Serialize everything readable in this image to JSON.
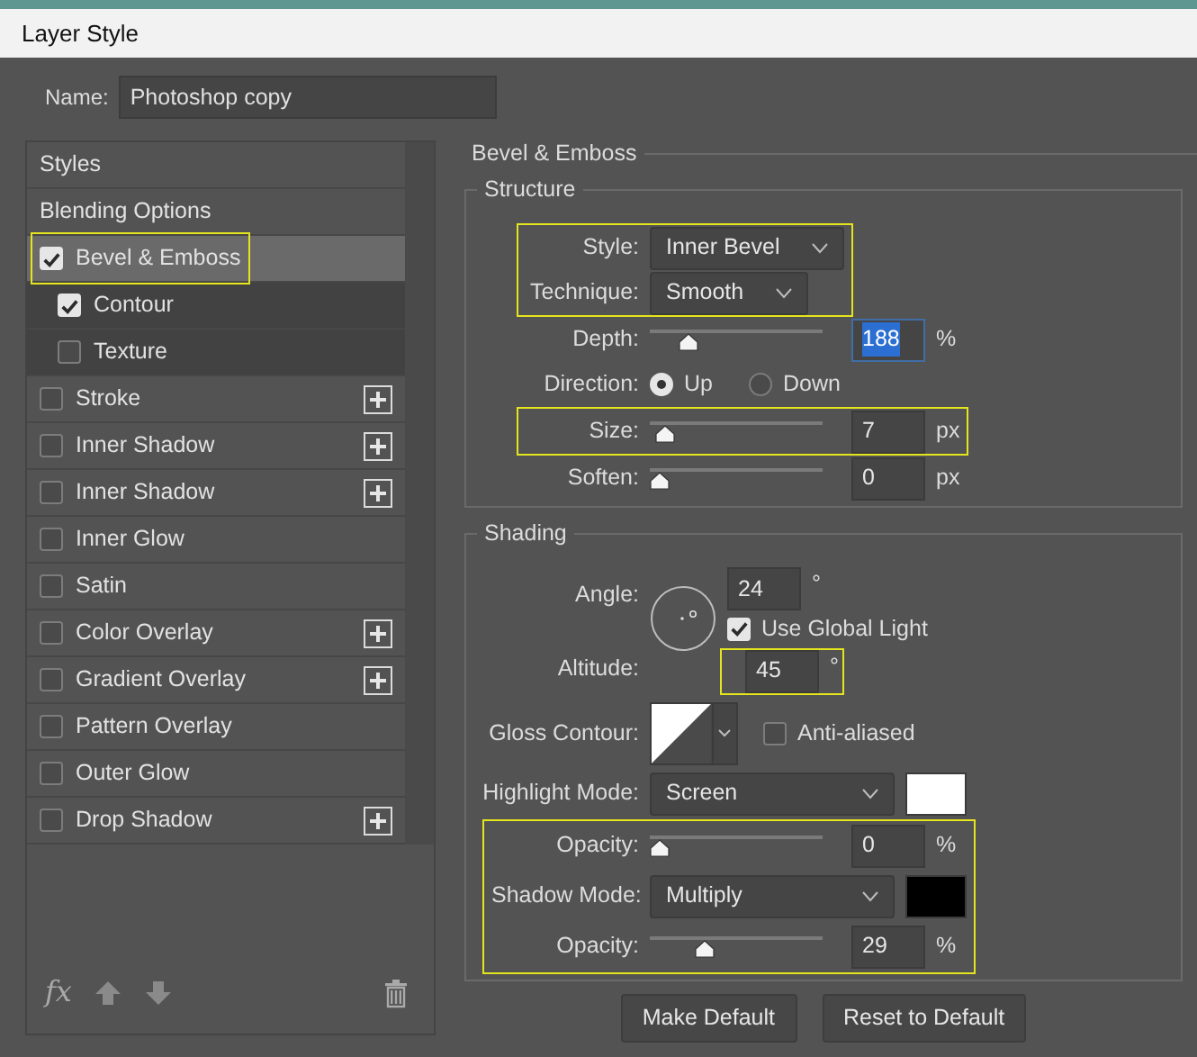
{
  "window": {
    "title": "Layer Style"
  },
  "name_field": {
    "label": "Name:",
    "value": "Photoshop copy"
  },
  "styles_list": [
    {
      "kind": "header",
      "label": "Styles",
      "selected": false
    },
    {
      "kind": "header",
      "label": "Blending Options",
      "selected": false
    },
    {
      "kind": "effect",
      "label": "Bevel & Emboss",
      "checked": true,
      "selected": true,
      "highlighted": true,
      "add_button": false,
      "children": [
        {
          "label": "Contour",
          "checked": true
        },
        {
          "label": "Texture",
          "checked": false
        }
      ]
    },
    {
      "kind": "effect",
      "label": "Stroke",
      "checked": false,
      "selected": false,
      "highlighted": false,
      "add_button": true
    },
    {
      "kind": "effect",
      "label": "Inner Shadow",
      "checked": false,
      "selected": false,
      "highlighted": false,
      "add_button": true
    },
    {
      "kind": "effect",
      "label": "Inner Shadow",
      "checked": false,
      "selected": false,
      "highlighted": false,
      "add_button": true
    },
    {
      "kind": "effect",
      "label": "Inner Glow",
      "checked": false,
      "selected": false,
      "highlighted": false,
      "add_button": false
    },
    {
      "kind": "effect",
      "label": "Satin",
      "checked": false,
      "selected": false,
      "highlighted": false,
      "add_button": false
    },
    {
      "kind": "effect",
      "label": "Color Overlay",
      "checked": false,
      "selected": false,
      "highlighted": false,
      "add_button": true
    },
    {
      "kind": "effect",
      "label": "Gradient Overlay",
      "checked": false,
      "selected": false,
      "highlighted": false,
      "add_button": true
    },
    {
      "kind": "effect",
      "label": "Pattern Overlay",
      "checked": false,
      "selected": false,
      "highlighted": false,
      "add_button": false
    },
    {
      "kind": "effect",
      "label": "Outer Glow",
      "checked": false,
      "selected": false,
      "highlighted": false,
      "add_button": false
    },
    {
      "kind": "effect",
      "label": "Drop Shadow",
      "checked": false,
      "selected": false,
      "highlighted": false,
      "add_button": true
    }
  ],
  "list_toolbar": {
    "fx_label": "fx"
  },
  "panel": {
    "title": "Bevel & Emboss",
    "structure": {
      "title": "Structure",
      "rows": [
        {
          "kind": "highlight",
          "rows": [
            {
              "kind": "select",
              "label": "Style:",
              "value": "Inner Bevel"
            },
            {
              "kind": "select",
              "label": "Technique:",
              "value": "Smooth"
            }
          ]
        },
        {
          "kind": "slider",
          "label": "Depth:",
          "level": 0.19,
          "value": "188",
          "unit": "%",
          "focused": true
        },
        {
          "kind": "radio",
          "label": "Direction:",
          "options": [
            {
              "label": "Up",
              "selected": true
            },
            {
              "label": "Down",
              "selected": false
            }
          ]
        },
        {
          "kind": "highlight",
          "rows": [
            {
              "kind": "slider",
              "label": "Size:",
              "level": 0.03,
              "value": "7",
              "unit": "px",
              "focused": false
            }
          ]
        },
        {
          "kind": "slider",
          "label": "Soften:",
          "level": 0,
          "value": "0",
          "unit": "px",
          "focused": false
        }
      ]
    },
    "shading": {
      "title": "Shading",
      "angle": {
        "label": "Angle:",
        "value": "24",
        "unit": "°"
      },
      "global_light": {
        "label": "Use Global Light",
        "checked": true
      },
      "altitude": {
        "label": "Altitude:",
        "value": "45",
        "unit": "°",
        "highlighted": true
      },
      "gloss_contour": {
        "label": "Gloss Contour:"
      },
      "anti_aliased": {
        "label": "Anti-aliased",
        "checked": false
      },
      "rows": [
        {
          "kind": "select",
          "label": "Highlight Mode:",
          "value": "Screen",
          "color": "#ffffff"
        },
        {
          "kind": "highlight",
          "rows": [
            {
              "kind": "slider",
              "label": "Opacity:",
              "level": 0,
              "value": "0",
              "unit": "%",
              "focused": false
            },
            {
              "kind": "select",
              "label": "Shadow Mode:",
              "value": "Multiply",
              "color": "#000000"
            },
            {
              "kind": "slider",
              "label": "Opacity:",
              "level": 0.29,
              "value": "29",
              "unit": "%",
              "focused": false
            }
          ]
        }
      ]
    },
    "buttons": [
      "Make Default",
      "Reset to Default"
    ]
  }
}
